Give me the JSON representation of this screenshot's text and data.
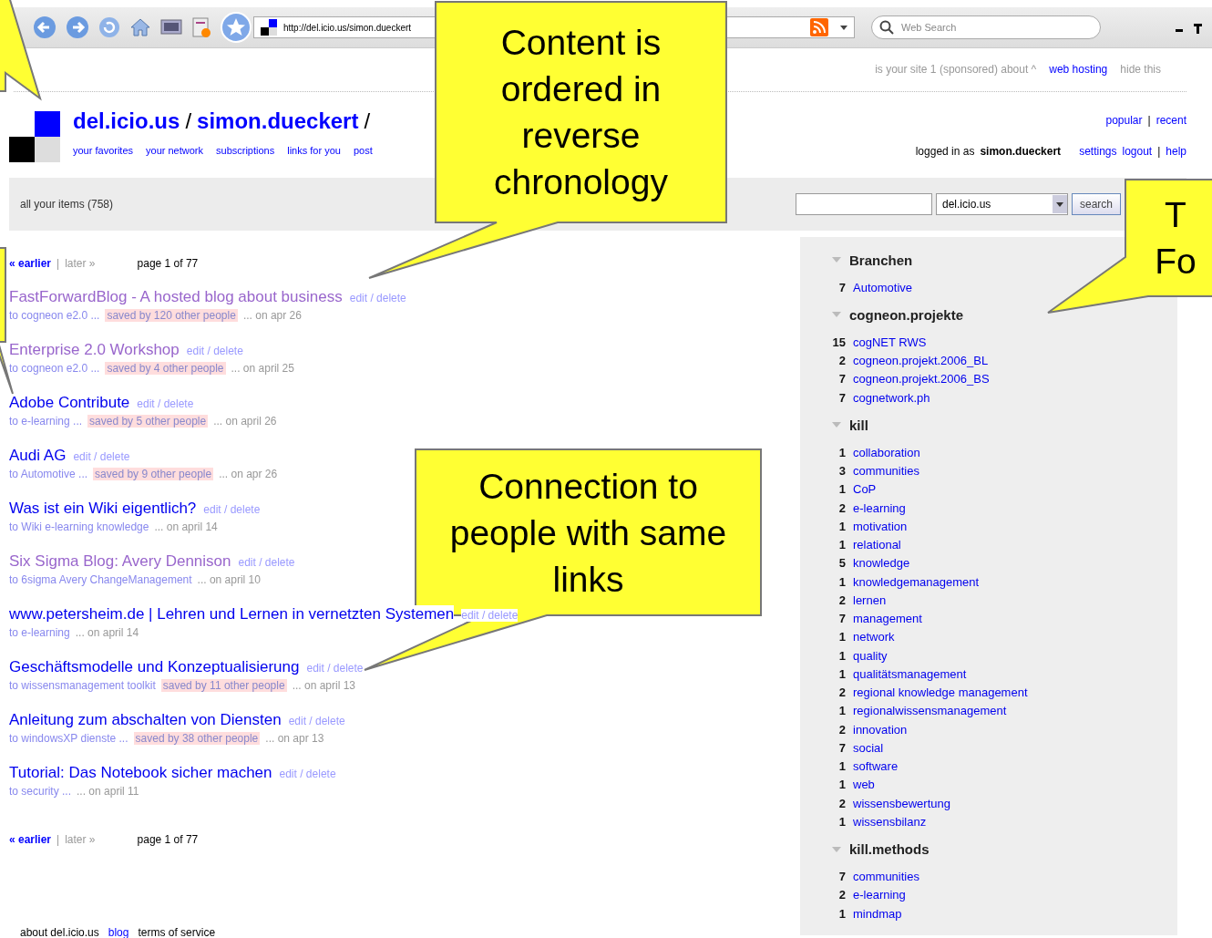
{
  "browser": {
    "url": "http://del.icio.us/simon.dueckert",
    "search": {
      "placeholder": "Web Search"
    }
  },
  "top_links": [
    {
      "text": "is your site 1 (sponsored) about ^",
      "kind": "plain"
    },
    {
      "text": "web hosting",
      "kind": "link"
    },
    {
      "text": "hide this",
      "kind": "plain"
    }
  ],
  "title": [
    {
      "text": "del.icio.us",
      "kind": "link"
    },
    {
      "text": "/",
      "kind": "sep"
    },
    {
      "text": "simon.dueckert",
      "kind": "link"
    },
    {
      "text": "/",
      "kind": "sep"
    }
  ],
  "nav": [
    "your favorites",
    "your network",
    "subscriptions",
    "links for you",
    "post"
  ],
  "account_links": [
    {
      "text": "popular",
      "kind": "link"
    },
    {
      "text": "|",
      "kind": "sep"
    },
    {
      "text": "recent",
      "kind": "link"
    }
  ],
  "login": {
    "text": "logged in as",
    "user": "simon.dueckert",
    "links": [
      {
        "text": "settings",
        "kind": "link"
      },
      {
        "text": "logout",
        "kind": "link"
      },
      {
        "text": "|",
        "kind": "sep"
      },
      {
        "text": "help",
        "kind": "link"
      }
    ]
  },
  "filter_bar": {
    "label": "all your items (758)",
    "select": "del.icio.us",
    "button": "search"
  },
  "pagination_top": {
    "earlier": "« earlier",
    "separator": "|",
    "later": "later »",
    "page": "page 1 of 77"
  },
  "posts": [
    {
      "title": "FastForwardBlog - A hosted blog about business",
      "visited": true,
      "action": "edit / delete",
      "tags": "to cogneon e2.0 ...",
      "saved": "saved by 120 other people",
      "date": "... on apr 26"
    },
    {
      "title": "Enterprise 2.0 Workshop",
      "visited": true,
      "action": "edit / delete",
      "tags": "to cogneon e2.0 ...",
      "saved": "saved by 4 other people",
      "date": "... on april 25"
    },
    {
      "title": "Adobe Contribute",
      "visited": false,
      "action": "edit / delete",
      "tags": "to e-learning ...",
      "saved": "saved by 5 other people",
      "date": "... on april 26"
    },
    {
      "title": "Audi AG",
      "visited": false,
      "action": "edit / delete",
      "tags": "to Automotive ...",
      "saved": "saved by 9 other people",
      "date": "... on apr 26"
    },
    {
      "title": "Was ist ein Wiki eigentlich?",
      "visited": false,
      "action": "edit / delete",
      "tags": "to Wiki e-learning knowledge",
      "date": "... on april 14"
    },
    {
      "title": "Six Sigma Blog: Avery Dennison",
      "visited": true,
      "action": "edit / delete",
      "tags": "to 6sigma Avery ChangeManagement",
      "date": "... on april 10"
    },
    {
      "title": "www.petersheim.de | Lehren und Lernen in vernetzten Systemen",
      "visited": false,
      "action": "edit / delete",
      "tags": "to e-learning",
      "date": "... on april 14"
    },
    {
      "title": "Geschäftsmodelle und Konzeptualisierung",
      "visited": false,
      "action": "edit / delete",
      "tags": "to wissensmanagement toolkit",
      "saved": "saved by 11 other people",
      "date": "... on april 13"
    },
    {
      "title": "Anleitung zum abschalten von Diensten",
      "visited": false,
      "action": "edit / delete",
      "tags": "to windowsXP dienste ...",
      "saved": "saved by 38 other people",
      "date": "... on apr 13"
    },
    {
      "title": "Tutorial: Das Notebook sicher machen",
      "visited": false,
      "action": "edit / delete",
      "tags": "to security ...",
      "date": "... on april 11"
    }
  ],
  "pagination_bottom": {
    "earlier": "« earlier",
    "separator": "|",
    "later": "later »",
    "page": "page 1 of 77"
  },
  "footer": [
    {
      "text": "about del.icio.us",
      "kind": "plain"
    },
    {
      "text": "blog",
      "kind": "link"
    },
    {
      "text": "terms of service",
      "kind": "plain"
    }
  ],
  "bundles": [
    {
      "name": "Branchen",
      "expanded": true,
      "tags": [
        {
          "count": "7",
          "name": "Automotive"
        }
      ]
    },
    {
      "name": "cogneon.projekte",
      "expanded": true,
      "tags": [
        {
          "count": "15",
          "name": "cogNET RWS"
        },
        {
          "count": "2",
          "name": "cogneon.projekt.2006_BL"
        },
        {
          "count": "7",
          "name": "cogneon.projekt.2006_BS"
        },
        {
          "count": "7",
          "name": "cognetwork.ph"
        }
      ]
    },
    {
      "name": "kill",
      "expanded": true,
      "tags": [
        {
          "count": "1",
          "name": "collaboration"
        },
        {
          "count": "3",
          "name": "communities"
        },
        {
          "count": "1",
          "name": "CoP"
        },
        {
          "count": "2",
          "name": "e-learning"
        },
        {
          "count": "1",
          "name": "motivation"
        },
        {
          "count": "1",
          "name": "relational"
        },
        {
          "count": "5",
          "name": "knowledge"
        },
        {
          "count": "1",
          "name": "knowledgemanagement"
        },
        {
          "count": "2",
          "name": "lernen"
        },
        {
          "count": "7",
          "name": "management"
        },
        {
          "count": "1",
          "name": "network"
        },
        {
          "count": "1",
          "name": "quality"
        },
        {
          "count": "1",
          "name": "qualitätsmanagement"
        },
        {
          "count": "2",
          "name": "regional knowledge management"
        },
        {
          "count": "1",
          "name": "regionalwissensmanagement"
        },
        {
          "count": "2",
          "name": "innovation"
        },
        {
          "count": "7",
          "name": "social"
        },
        {
          "count": "1",
          "name": "software"
        },
        {
          "count": "1",
          "name": "web"
        },
        {
          "count": "2",
          "name": "wissensbewertung"
        },
        {
          "count": "1",
          "name": "wissensbilanz"
        }
      ]
    },
    {
      "name": "kill.methods",
      "expanded": true,
      "tags": [
        {
          "count": "7",
          "name": "communities"
        },
        {
          "count": "2",
          "name": "e-learning"
        },
        {
          "count": "1",
          "name": "mindmap"
        }
      ]
    }
  ],
  "callouts": [
    {
      "kind": "callout"
    },
    {
      "kind": "callout",
      "lines": [
        "Content is",
        "ordered in",
        "reverse",
        "chronology"
      ]
    },
    {
      "kind": "callout"
    },
    {
      "kind": "callout",
      "lines": [
        "Connection to",
        "people with same",
        "links"
      ]
    },
    {
      "kind": "callout",
      "lines": [
        "T",
        "Fo"
      ]
    }
  ]
}
